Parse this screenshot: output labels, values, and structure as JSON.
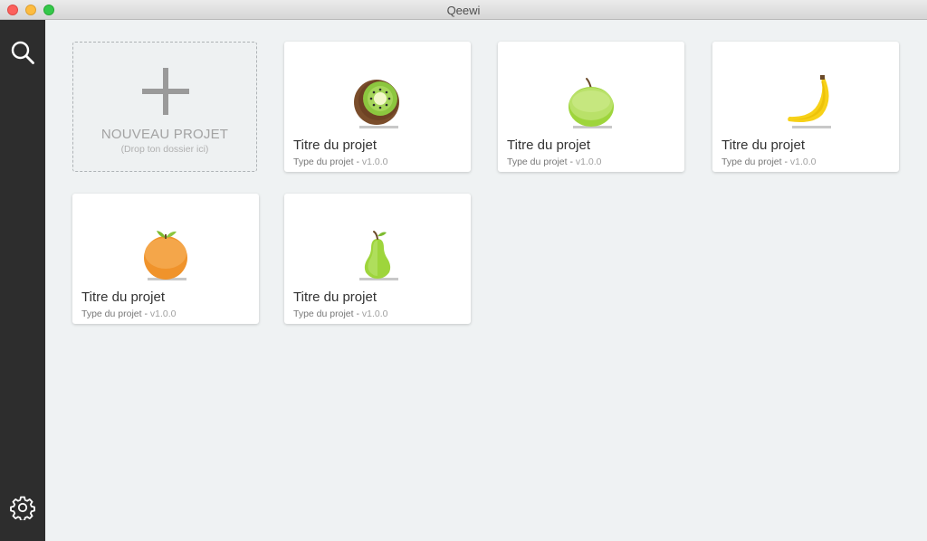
{
  "window": {
    "title": "Qeewi"
  },
  "sidebar": {
    "top_icon": "search-icon",
    "bottom_icon": "gear-icon"
  },
  "new_project": {
    "title": "NOUVEAU PROJET",
    "subtitle": "(Drop ton dossier ici)",
    "icon": "plus-icon"
  },
  "projects": [
    {
      "title": "Titre du projet",
      "type": "Type du projet - ",
      "version": "v1.0.0",
      "icon": "kiwi-icon"
    },
    {
      "title": "Titre du projet",
      "type": "Type du projet - ",
      "version": "v1.0.0",
      "icon": "apple-icon"
    },
    {
      "title": "Titre du projet",
      "type": "Type du projet - ",
      "version": "v1.0.0",
      "icon": "banana-icon"
    },
    {
      "title": "Titre du projet",
      "type": "Type du projet - ",
      "version": "v1.0.0",
      "icon": "orange-icon"
    },
    {
      "title": "Titre du projet",
      "type": "Type du projet - ",
      "version": "v1.0.0",
      "icon": "pear-icon"
    }
  ],
  "colors": {
    "sidebar": "#2d2d2d",
    "background": "#eff2f3",
    "card": "#ffffff"
  }
}
